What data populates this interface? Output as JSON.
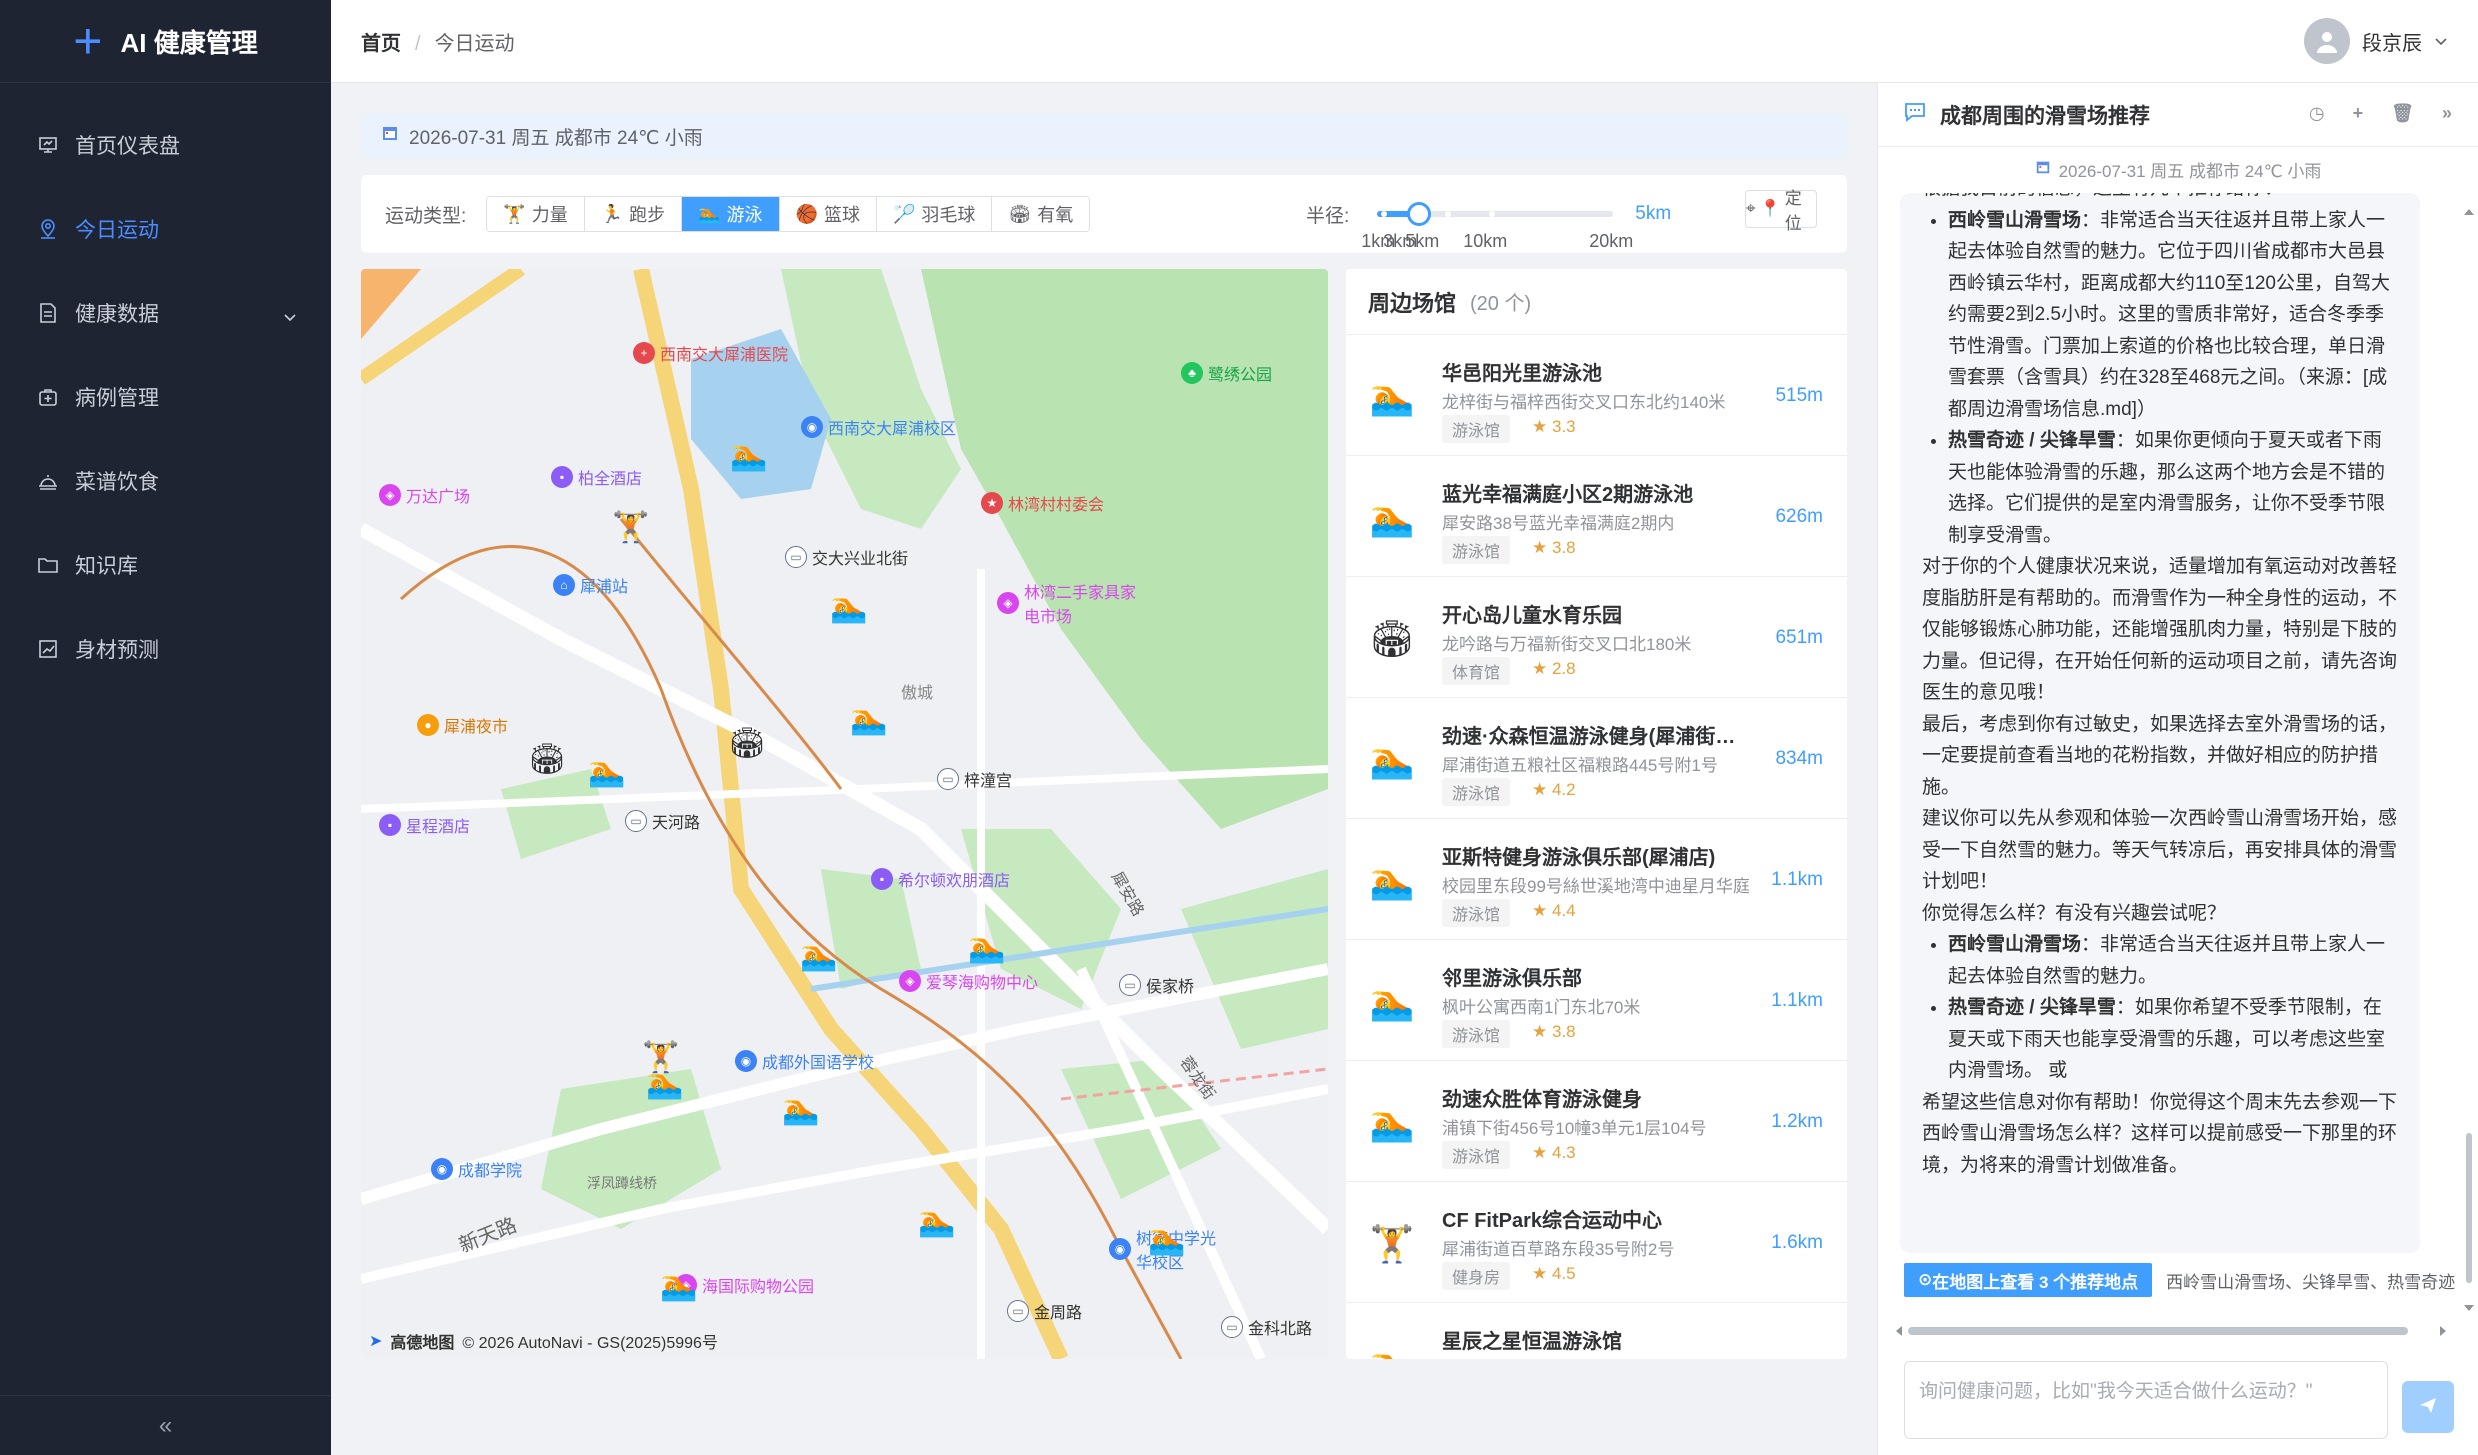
{
  "app": {
    "title": "AI 健康管理"
  },
  "sidebar": {
    "items": [
      {
        "label": "首页仪表盘",
        "icon": "dashboard-icon"
      },
      {
        "label": "今日运动",
        "icon": "location-icon"
      },
      {
        "label": "健康数据",
        "icon": "document-icon"
      },
      {
        "label": "病例管理",
        "icon": "medical-case-icon"
      },
      {
        "label": "菜谱饮食",
        "icon": "food-icon"
      },
      {
        "label": "知识库",
        "icon": "folder-icon"
      },
      {
        "label": "身材预测",
        "icon": "trend-chart-icon"
      }
    ],
    "active_index": 1,
    "collapse_icon": "double-chevron-left-icon"
  },
  "header": {
    "breadcrumb": [
      "首页",
      "今日运动"
    ],
    "separator": "/",
    "user_name": "段京辰"
  },
  "weather": {
    "text": "2026-07-31 周五 成都市 24℃ 小雨"
  },
  "filter": {
    "type_label": "运动类型:",
    "types": [
      "力量",
      "跑步",
      "游泳",
      "篮球",
      "羽毛球",
      "有氧"
    ],
    "active_type": "游泳",
    "radius_label": "半径:",
    "radius_value": "5km",
    "radius_fraction": 0.18,
    "ticks": [
      "1km",
      "3km",
      "5km",
      "10km",
      "20km"
    ],
    "locate_label": "定位"
  },
  "map": {
    "pois": [
      {
        "name": "西南交大犀浦医院",
        "color": "#e5484d"
      },
      {
        "name": "西南交大犀浦校区",
        "color": "#3b82f6"
      },
      {
        "name": "柏全酒店",
        "color": "#8b5cf6"
      },
      {
        "name": "万达广场",
        "color": "#d946ef"
      },
      {
        "name": "林湾村村委会",
        "color": "#e5484d"
      },
      {
        "name": "交大兴业北街",
        "color": "#64748b"
      },
      {
        "name": "犀浦站",
        "color": "#3b82f6"
      },
      {
        "name": "林湾二手家具家电市场",
        "color": "#d946ef"
      },
      {
        "name": "鹭绣公园",
        "color": "#22c55e"
      },
      {
        "name": "犀浦夜市",
        "color": "#f59e0b"
      },
      {
        "name": "天河路",
        "color": "#64748b"
      },
      {
        "name": "梓潼宫",
        "color": "#64748b"
      },
      {
        "name": "星程酒店",
        "color": "#8b5cf6"
      },
      {
        "name": "希尔顿欢朋酒店",
        "color": "#8b5cf6"
      },
      {
        "name": "爱琴海购物中心",
        "color": "#d946ef"
      },
      {
        "name": "侯家桥",
        "color": "#64748b"
      },
      {
        "name": "成都外国语学校",
        "color": "#3b82f6"
      },
      {
        "name": "成都学院",
        "color": "#3b82f6"
      },
      {
        "name": "海国际购物公园",
        "color": "#d946ef"
      },
      {
        "name": "金周路",
        "color": "#64748b"
      },
      {
        "name": "金科北路",
        "color": "#64748b"
      },
      {
        "name": "树德中学光华校区",
        "color": "#3b82f6"
      }
    ],
    "road_labels": [
      "傲城",
      "犀安路",
      "新天路",
      "浮凤蹲线桥",
      "蓉龙街"
    ],
    "copyright": "© 2026 AutoNavi - GS(2025)5996号",
    "logo_text": "高德地图"
  },
  "venues": {
    "title": "周边场馆",
    "count": "(20 个)",
    "items": [
      {
        "name": "华邑阳光里游泳池",
        "address": "龙梓街与福梓西街交叉口东北约140米",
        "tag": "游泳馆",
        "rating": "3.3",
        "distance": "515m",
        "icon": "swimming-icon"
      },
      {
        "name": "蓝光幸福满庭小区2期游泳池",
        "address": "犀安路38号蓝光幸福满庭2期内",
        "tag": "游泳馆",
        "rating": "3.8",
        "distance": "626m",
        "icon": "swimming-icon"
      },
      {
        "name": "开心岛儿童水育乐园",
        "address": "龙吟路与万福新街交叉口北180米",
        "tag": "体育馆",
        "rating": "2.8",
        "distance": "651m",
        "icon": "stadium-icon"
      },
      {
        "name": "劲速·众森恒温游泳健身(犀浦街道店)",
        "address": "犀浦街道五粮社区福粮路445号附1号",
        "tag": "游泳馆",
        "rating": "4.2",
        "distance": "834m",
        "icon": "swimming-icon"
      },
      {
        "name": "亚斯特健身游泳俱乐部(犀浦店)",
        "address": "校园里东段99号絲世溪地湾中迪星月华庭",
        "tag": "游泳馆",
        "rating": "4.4",
        "distance": "1.1km",
        "icon": "swimming-icon"
      },
      {
        "name": "邻里游泳俱乐部",
        "address": "枫叶公寓西南1门东北70米",
        "tag": "游泳馆",
        "rating": "3.8",
        "distance": "1.1km",
        "icon": "swimming-icon"
      },
      {
        "name": "劲速众胜体育游泳健身",
        "address": "浦镇下街456号10幢3单元1层104号",
        "tag": "游泳馆",
        "rating": "4.3",
        "distance": "1.2km",
        "icon": "swimming-icon"
      },
      {
        "name": "CF FitPark综合运动中心",
        "address": "犀浦街道百草路东段35号附2号",
        "tag": "健身房",
        "rating": "4.5",
        "distance": "1.6km",
        "icon": "weightlifting-icon"
      },
      {
        "name": "星辰之星恒温游泳馆",
        "address": "",
        "tag": "",
        "rating": "",
        "distance": "",
        "icon": "swimming-icon"
      }
    ]
  },
  "chat": {
    "title": "成都周围的滑雪场推荐",
    "weather": "2026-07-31 周五 成都市 24℃ 小雨",
    "top_cut": "根据我目前的信息，这里有几个推荐给你：",
    "list1": [
      {
        "name": "西岭雪山滑雪场",
        "text": "：非常适合当天往返并且带上家人一起去体验自然雪的魅力。它位于四川省成都市大邑县西岭镇云华村，距离成都大约110至120公里，自驾大约需要2到2.5小时。这里的雪质非常好，适合冬季季节性滑雪。门票加上索道的价格也比较合理，单日滑雪套票（含雪具）约在328至468元之间。（来源：[成都周边滑雪场信息.md]）"
      },
      {
        "name": "热雪奇迹 / 尖锋旱雪",
        "text": "：如果你更倾向于夏天或者下雨天也能体验滑雪的乐趣，那么这两个地方会是不错的选择。它们提供的是室内滑雪服务，让你不受季节限制享受滑雪。"
      }
    ],
    "para1": "对于你的个人健康状况来说，适量增加有氧运动对改善轻度脂肪肝是有帮助的。而滑雪作为一种全身性的运动，不仅能够锻炼心肺功能，还能增强肌肉力量，特别是下肢的力量。但记得，在开始任何新的运动项目之前，请先咨询医生的意见哦！",
    "para2": "最后，考虑到你有过敏史，如果选择去室外滑雪场的话，一定要提前查看当地的花粉指数，并做好相应的防护措施。",
    "para3": "建议你可以先从参观和体验一次西岭雪山滑雪场开始，感受一下自然雪的魅力。等天气转凉后，再安排具体的滑雪计划吧！",
    "para4": "你觉得怎么样？有没有兴趣尝试呢？",
    "list2": [
      {
        "name": "西岭雪山滑雪场",
        "text": "：非常适合当天往返并且带上家人一起去体验自然雪的魅力。"
      },
      {
        "name": "热雪奇迹 / 尖锋旱雪",
        "text": "：如果你希望不受季节限制，在夏天或下雨天也能享受滑雪的乐趣，可以考虑这些室内滑雪场。 或"
      }
    ],
    "para5": "希望这些信息对你有帮助！你觉得这个周末先去参观一下西岭雪山滑雪场怎么样？这样可以提前感受一下那里的环境，为将来的滑雪计划做准备。",
    "map_button": "在地图上查看 3 个推荐地点",
    "map_places": "西岭雪山滑雪场、尖锋旱雪、热雪奇迹",
    "input_placeholder": "询问健康问题，比如\"我今天适合做什么运动？\""
  }
}
